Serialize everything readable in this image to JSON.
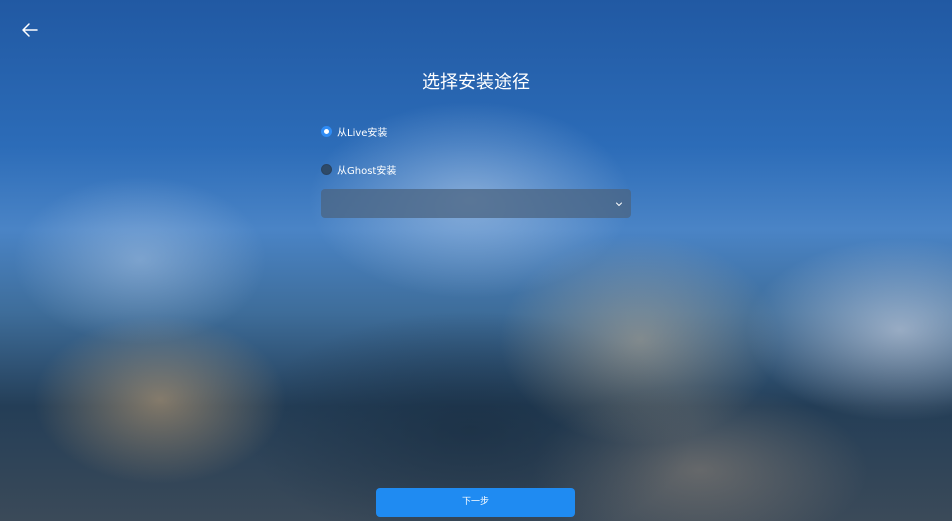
{
  "header": {
    "back_icon": "arrow-left-icon",
    "title": "选择安装途径"
  },
  "options": [
    {
      "label": "从Live安装",
      "checked": true
    },
    {
      "label": "从Ghost安装",
      "checked": false
    }
  ],
  "image_select": {
    "value": "",
    "chevron_icon": "chevron-down-icon"
  },
  "footer": {
    "next_label": "下一步"
  },
  "colors": {
    "accent": "#1f8bf2",
    "radio_checked": "#2f8cf5"
  }
}
